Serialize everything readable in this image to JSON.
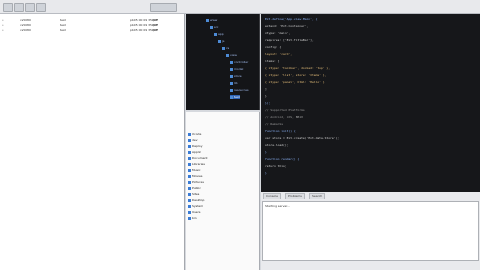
{
  "toolbar": {
    "buttons": [
      "back",
      "forward",
      "refresh",
      "stop",
      "search"
    ]
  },
  "files": [
    [
      "•",
      "cs5080",
      "test",
      "pb05 00 09 35.pdf",
      "PDF"
    ],
    [
      "•",
      "cs5080",
      "test",
      "pb05 00 09 35.pdf",
      "PDF"
    ],
    [
      "•",
      "cs5080",
      "test",
      "pb05 00 09 35.pdf",
      "PDF"
    ]
  ],
  "tree": [
    "www",
    "src",
    "app",
    "js",
    "cs",
    "view",
    "controller",
    "model",
    "store",
    "lib",
    "resources",
    "test"
  ],
  "lower_tree": [
    "Xcode",
    "dev",
    "Deploy",
    "Applic",
    "Document",
    "Libraries",
    "Music",
    "Movies",
    "Pictures",
    "Public",
    "Sites",
    "Desktop",
    "System",
    "Users",
    "bin"
  ],
  "code": [
    {
      "t": "Ext.define('App.view.Main', {",
      "c": "#8fb8ff"
    },
    {
      "t": "  extend: 'Ext.Container',",
      "c": "#d6d6d6"
    },
    {
      "t": "  xtype: 'main',",
      "c": "#d6d6d6"
    },
    {
      "t": "  requires: ['Ext.TitleBar'],",
      "c": "#d6d6d6"
    },
    {
      "t": "  config: {",
      "c": "#d6d6d6"
    },
    {
      "t": "    layout: 'card',",
      "c": "#e8c07b"
    },
    {
      "t": "    items: [",
      "c": "#d6d6d6"
    },
    {
      "t": "      { xtype: 'toolbar', docked: 'top' },",
      "c": "#e8c07b"
    },
    {
      "t": "      { xtype: 'list', store: 'Items' },",
      "c": "#e8c07b"
    },
    {
      "t": "      { xtype: 'panel', html: 'Hello' }",
      "c": "#e8c07b"
    },
    {
      "t": "    ]",
      "c": "#d6d6d6"
    },
    {
      "t": "  }",
      "c": "#d6d6d6"
    },
    {
      "t": "});",
      "c": "#8fb8ff"
    },
    {
      "t": "// Supported Platforms",
      "c": "#9b9b9b"
    },
    {
      "t": "// Android, iOS, BB10",
      "c": "#9b9b9b"
    },
    {
      "t": "// Remarks",
      "c": "#9b9b9b"
    },
    {
      "t": "function init() {",
      "c": "#8fb8ff"
    },
    {
      "t": "  var store = Ext.create('Ext.data.Store');",
      "c": "#d6d6d6"
    },
    {
      "t": "  store.load();",
      "c": "#d6d6d6"
    },
    {
      "t": "}",
      "c": "#8fb8ff"
    },
    {
      "t": "function render() {",
      "c": "#8fb8ff"
    },
    {
      "t": "  return this;",
      "c": "#d6d6d6"
    },
    {
      "t": "}",
      "c": "#8fb8ff"
    }
  ],
  "console": {
    "tabs": [
      "Console",
      "Problems",
      "Search"
    ],
    "line": "Starting server..."
  }
}
